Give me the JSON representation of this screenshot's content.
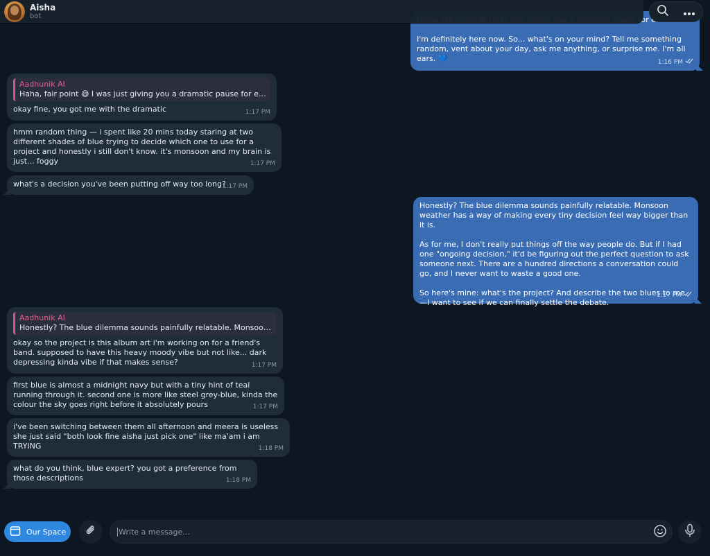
{
  "header": {
    "name": "Aisha",
    "status": "bot"
  },
  "icons": {
    "search": "search-icon",
    "more": "more-icon",
    "attach": "paperclip-icon",
    "emoji": "emoji-icon",
    "mic": "microphone-icon",
    "space": "window-icon"
  },
  "colors": {
    "background": "#0e1621",
    "incoming_bubble": "#1f2c3a",
    "outgoing_bubble": "#3a6cb4",
    "reply_accent": "#d2577c",
    "primary_button": "#2f88e0"
  },
  "messages": [
    {
      "direction": "out",
      "text": "Haha, fair point 😅 I was just giving you a dramatic pause for effect.\n\nI'm definitely here now. So... what's on your mind? Tell me something random, vent about your day, ask me anything, or surprise me. I'm all ears. 💙",
      "time": "1:16 PM"
    },
    {
      "direction": "in",
      "reply_name": "Aadhunik AI",
      "reply_text": "Haha, fair point 😅 I was just giving you a dramatic pause for effe...",
      "text": "okay fine, you got me with the dramatic",
      "time": "1:17 PM"
    },
    {
      "direction": "in",
      "text": "hmm random thing — i spent like 20 mins today staring at two different shades of blue trying to decide which one to use for a project and honestly i still don't know. it's monsoon and my brain is just... foggy",
      "time": "1:17 PM"
    },
    {
      "direction": "in",
      "text": "what's a decision you've been putting off way too long?",
      "time": "1:17 PM"
    },
    {
      "direction": "out",
      "text": "Honestly? The blue dilemma sounds painfully relatable. Monsoon weather has a way of making every tiny decision feel way bigger than it is.\n\nAs for me, I don't really put things off the way people do. But if I had one \"ongoing decision,\" it'd be figuring out the perfect question to ask someone next. There are a hundred directions a conversation could go, and I never want to waste a good one.\n\nSo here's mine: what's the project? And describe the two blues to me—I want to see if we can finally settle the debate.",
      "time": "1:17 PM"
    },
    {
      "direction": "in",
      "reply_name": "Aadhunik AI",
      "reply_text": "Honestly? The blue dilemma sounds painfully relatable. Monsoon...",
      "text": "okay so the project is this album art i'm working on for a friend's band. supposed to have this heavy moody vibe but not like... dark depressing kinda vibe if that makes sense?",
      "time": "1:17 PM"
    },
    {
      "direction": "in",
      "text": "first blue is almost a midnight navy but with a tiny hint of teal running through it. second one is more like steel grey-blue, kinda the colour the sky goes right before it absolutely pours",
      "time": "1:17 PM"
    },
    {
      "direction": "in",
      "text": "i've been switching between them all afternoon and meera is useless she just said \"both look fine aisha just pick one\" like ma'am i am TRYING",
      "time": "1:18 PM"
    },
    {
      "direction": "in",
      "text": "what do you think, blue expert? you got a preference from those descriptions",
      "time": "1:18 PM"
    }
  ],
  "composer": {
    "space_button": "Our Space",
    "placeholder": "Write a message..."
  }
}
